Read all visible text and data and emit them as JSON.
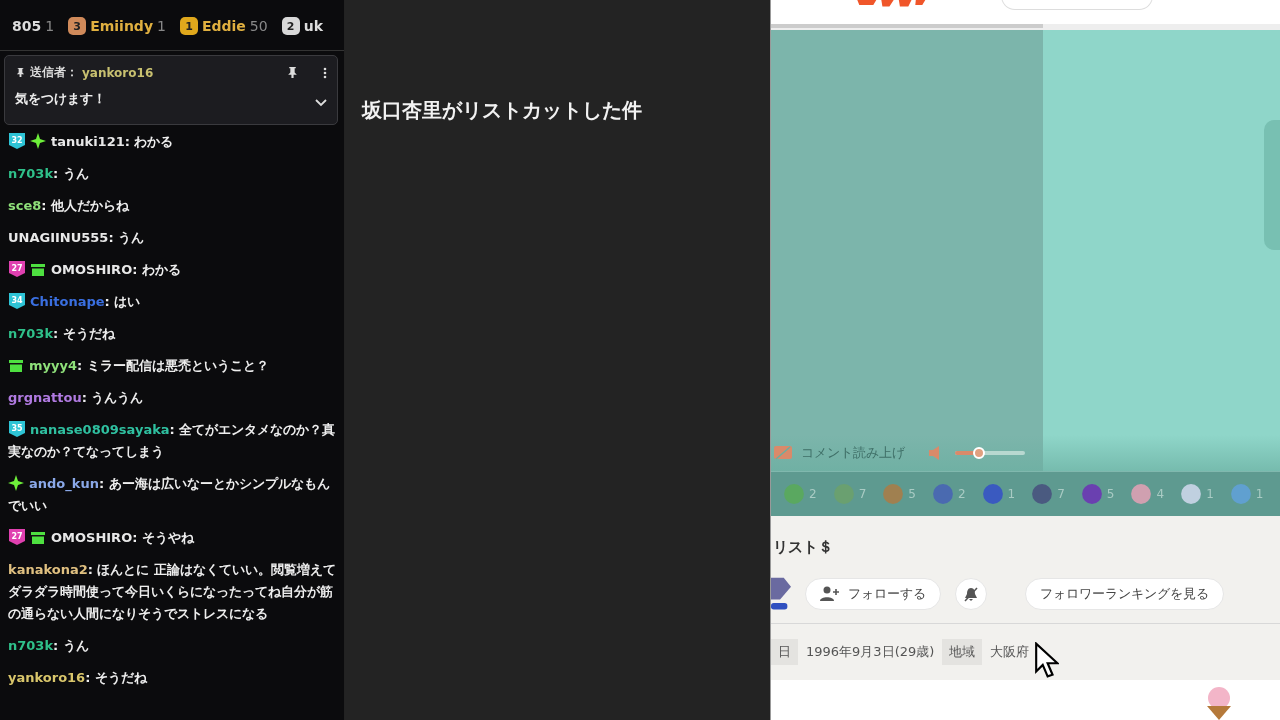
{
  "leaderboard": [
    {
      "name": "805",
      "count": "1"
    },
    {
      "rank": "3",
      "name": "Emiindy",
      "count": "1",
      "color": "#d08a5a"
    },
    {
      "rank": "1",
      "name": "Eddie",
      "count": "50",
      "color": "#e0a81c"
    },
    {
      "rank": "2",
      "name": "uk",
      "color": "#d8d8d8"
    }
  ],
  "pinned": {
    "label": "送信者：",
    "user": "yankoro16",
    "text": "気をつけます！"
  },
  "messages": [
    {
      "badges": [
        {
          "kind": "sub",
          "label": "32",
          "color": "#2ec4d6"
        },
        {
          "kind": "sparkle"
        }
      ],
      "user": "tanuki121",
      "color": "#e8e8e8",
      "text": ": わかる"
    },
    {
      "user": "n703k",
      "color": "#2fc08a",
      "text": ": うん"
    },
    {
      "user": "sce8",
      "color": "#8fe07a",
      "text": ": 他人だからね"
    },
    {
      "user": "UNAGIINU555",
      "color": "#e8e8e8",
      "text": ": うん"
    },
    {
      "badges": [
        {
          "kind": "sub",
          "label": "27",
          "color": "#e040b0"
        },
        {
          "kind": "gift"
        }
      ],
      "user": "OMOSHIRO",
      "color": "#e8e8e8",
      "text": ": わかる"
    },
    {
      "badges": [
        {
          "kind": "sub",
          "label": "34",
          "color": "#2ec4d6"
        }
      ],
      "user": "Chitonape",
      "color": "#3a6fe0",
      "text": ": はい"
    },
    {
      "user": "n703k",
      "color": "#2fc08a",
      "text": ": そうだね"
    },
    {
      "badges": [
        {
          "kind": "gift"
        }
      ],
      "user": "myyy4",
      "color": "#8fe07a",
      "text": ": ミラー配信は悪禿ということ？"
    },
    {
      "user": "grgnattou",
      "color": "#b07ae0",
      "text": ": うんうん"
    },
    {
      "badges": [
        {
          "kind": "sub",
          "label": "35",
          "color": "#2ec4d6"
        }
      ],
      "user": "nanase0809sayaka",
      "color": "#2fc0a0",
      "text": ": 全てがエンタメなのか？真実なのか？てなってしまう"
    },
    {
      "badges": [
        {
          "kind": "sparkle"
        }
      ],
      "user": "ando_kun",
      "color": "#8aa8e8",
      "text": ": あー海は広いなーとかシンプルなもんでいい"
    },
    {
      "badges": [
        {
          "kind": "sub",
          "label": "27",
          "color": "#e040b0"
        },
        {
          "kind": "gift"
        }
      ],
      "user": "OMOSHIRO",
      "color": "#e8e8e8",
      "text": ": そうやね"
    },
    {
      "user": "kanakona2",
      "color": "#e0c080",
      "text": ": ほんとに 正論はなくていい。閲覧増えてダラダラ時間使って今日いくらになったってね自分が筋の通らない人間になりそうでストレスになる"
    },
    {
      "user": "n703k",
      "color": "#2fc08a",
      "text": ": うん"
    },
    {
      "user": "yankoro16",
      "color": "#d9c66b",
      "text": ": そうだね"
    }
  ],
  "headline": "坂口杏里がリストカットした件",
  "player": {
    "read_aloud": "コメント読み上げ",
    "volume": {
      "level": 0.34
    }
  },
  "gifts": [
    {
      "count": "2",
      "color": "#5aa860"
    },
    {
      "count": "7",
      "color": "#6aa070"
    },
    {
      "count": "5",
      "color": "#a08050"
    },
    {
      "count": "2",
      "color": "#4a6ab0"
    },
    {
      "count": "1",
      "color": "#3a5ac0"
    },
    {
      "count": "7",
      "color": "#4a5a80"
    },
    {
      "count": "5",
      "color": "#6a40b0"
    },
    {
      "count": "4",
      "color": "#d0a0b0"
    },
    {
      "count": "1",
      "color": "#c0d0e0"
    },
    {
      "count": "1",
      "color": "#60a0d0"
    }
  ],
  "profile": {
    "name": "リスト＄",
    "follow": "フォローする",
    "ranking": "フォロワーランキングを見る",
    "info": [
      {
        "kind": "tag",
        "text": "日"
      },
      {
        "kind": "value",
        "text": "1996年9月3日(29歳)"
      },
      {
        "kind": "tag",
        "text": "地域"
      },
      {
        "kind": "value",
        "text": "大阪府"
      }
    ]
  }
}
